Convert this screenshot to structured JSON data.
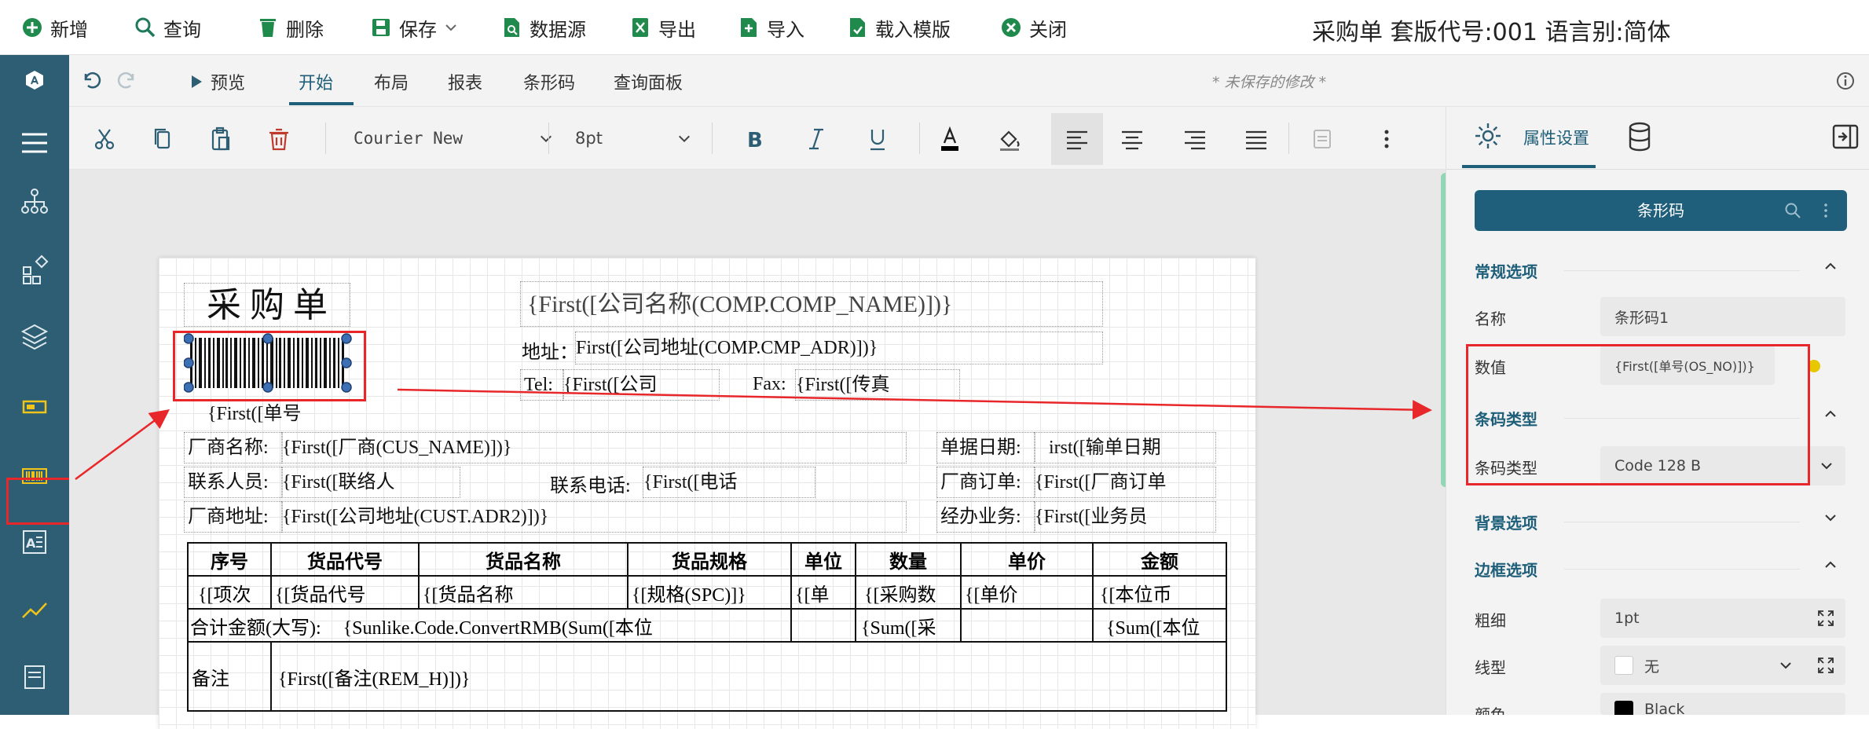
{
  "toolbar": {
    "new": "新增",
    "query": "查询",
    "delete": "删除",
    "save": "保存",
    "datasource": "数据源",
    "export": "导出",
    "import": "导入",
    "load_template": "载入模版",
    "close": "关闭"
  },
  "window_title": "采购单 套版代号:001 语言别:简体",
  "ribbon": {
    "preview": "预览",
    "tabs": [
      "开始",
      "布局",
      "报表",
      "条形码",
      "查询面板"
    ],
    "unsaved": "* 未保存的修改 *"
  },
  "format": {
    "font": "Courier New",
    "size": "8pt"
  },
  "report": {
    "title": "采 购 单",
    "company_name": "{First([公司名称(COMP.COMP_NAME)])}",
    "addr_label": "地址：",
    "addr_value": "First([公司地址(COMP.CMP_ADR)])}",
    "tel_label": "Tel:",
    "tel_value": "{First([公司",
    "fax_label": "Fax:",
    "fax_value": "{First([传真",
    "barcode_caption": "{First([单号",
    "vendor_label": "厂商名称:",
    "vendor_value": "{First([厂商(CUS_NAME)])}",
    "contact_label": "联系人员:",
    "contact_value": "{First([联络人",
    "phone_label": "联系电话:",
    "phone_value": "{First([电话",
    "vaddr_label": "厂商地址:",
    "vaddr_value": "{First([公司地址(CUST.ADR2)])}",
    "date_label": "单据日期:",
    "date_value": "irst([输单日期",
    "order_label": "厂商订单:",
    "order_value": "{First([厂商订单",
    "staff_label": "经办业务:",
    "staff_value": "{First([业务员",
    "columns": [
      "序号",
      "货品代号",
      "货品名称",
      "货品规格",
      "单位",
      "数量",
      "单价",
      "金额"
    ],
    "row": [
      "{[项次",
      "{[货品代号",
      "{[货品名称",
      "{[规格(SPC)]}",
      "{[单",
      "{[采购数",
      "{[单价",
      "{[本位币"
    ],
    "total_label": "合计金额(大写):",
    "total_value": "{Sunlike.Code.ConvertRMB(Sum([本位",
    "total_qty": "{Sum([采",
    "total_amount": "{Sum([本位",
    "remark_label": "备注",
    "remark_value": "{First([备注(REM_H)])}"
  },
  "panel": {
    "tab_props": "属性设置",
    "component": "条形码",
    "sec_general": "常规选项",
    "name_label": "名称",
    "name_value": "条形码1",
    "value_label": "数值",
    "value_value": "{First([单号(OS_NO)])}",
    "sec_codetype": "条码类型",
    "type_label": "条码类型",
    "type_value": "Code 128 B",
    "sec_bg": "背景选项",
    "sec_border": "边框选项",
    "width_label": "粗细",
    "width_value": "1pt",
    "style_label": "线型",
    "style_value": "无",
    "color_label": "颜色",
    "color_value": "Black"
  },
  "colors": {
    "nav": "#2d5e74",
    "accent": "#1d5e79",
    "annotation": "#e8272b",
    "status_dot": "#e6c700"
  }
}
